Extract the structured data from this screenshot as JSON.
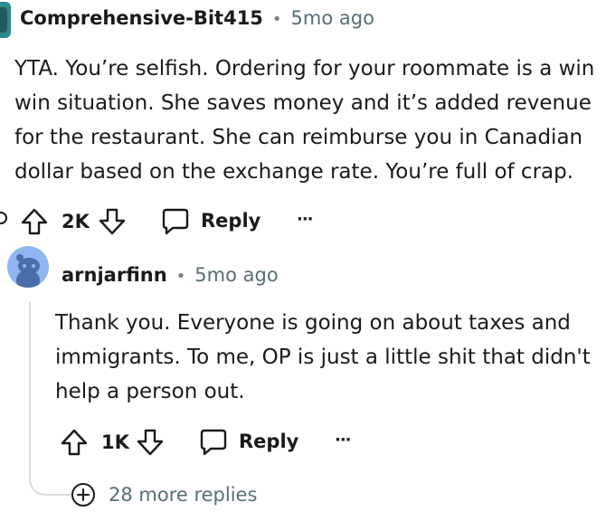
{
  "comment1": {
    "username": "Comprehensive-Bit415",
    "separator": "•",
    "time": "5mo ago",
    "lines": [
      "YTA. You’re selfish. Ordering for your roommate is a win",
      "win situation. She saves money and it’s added revenue",
      "for the restaurant. She can reimburse you in Canadian",
      "dollar based on the exchange rate. You’re full of crap."
    ],
    "votes": "2K",
    "reply_label": "Reply",
    "more_label": "···"
  },
  "comment2": {
    "username": "arnjarfinn",
    "separator": "•",
    "time": "5mo ago",
    "lines": [
      "Thank you. Everyone is going on about taxes and",
      "immigrants. To me, OP is just a little shit that didn't",
      "help a person out."
    ],
    "votes": "1K",
    "reply_label": "Reply",
    "more_label": "···"
  },
  "more_replies": "28 more replies",
  "icons": {
    "upvote": "arrow-up-icon",
    "downvote": "arrow-down-icon",
    "reply": "speech-bubble-icon",
    "more": "ellipsis-icon",
    "expand": "plus-circle-icon"
  },
  "colors": {
    "avatar1": "#2e8b8b",
    "avatar2": "#8fb6f0",
    "thread": "#d7dadc",
    "meta": "#576f76"
  }
}
